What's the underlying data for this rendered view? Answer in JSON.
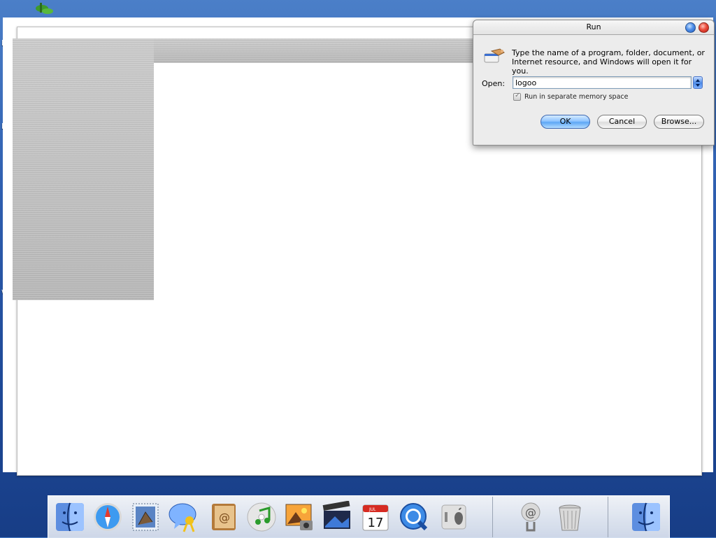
{
  "desktop": {
    "edge_labels": [
      "M",
      "M",
      "wi"
    ]
  },
  "run_dialog": {
    "title": "Run",
    "description": "Type the name of a program, folder, document, or Internet resource, and Windows will open it for you.",
    "open_label": "Open:",
    "open_value": "logoo",
    "checkbox_label": "Run in separate memory space",
    "checkbox_checked": true,
    "checkbox_enabled": false,
    "ok_label": "OK",
    "cancel_label": "Cancel",
    "browse_label": "Browse..."
  },
  "dock": {
    "items": [
      {
        "icon": "finder-icon"
      },
      {
        "icon": "safari-icon"
      },
      {
        "icon": "mail-icon"
      },
      {
        "icon": "ichat-icon"
      },
      {
        "icon": "address-book-icon"
      },
      {
        "icon": "itunes-icon"
      },
      {
        "icon": "iphoto-icon"
      },
      {
        "icon": "imovie-icon"
      },
      {
        "icon": "ical-icon",
        "date_month": "JUL",
        "date_day": "17"
      },
      {
        "icon": "quicktime-icon"
      },
      {
        "icon": "system-preferences-icon"
      },
      {
        "icon": "mail-at-icon"
      },
      {
        "icon": "trash-icon"
      },
      {
        "icon": "finder-icon"
      }
    ]
  }
}
